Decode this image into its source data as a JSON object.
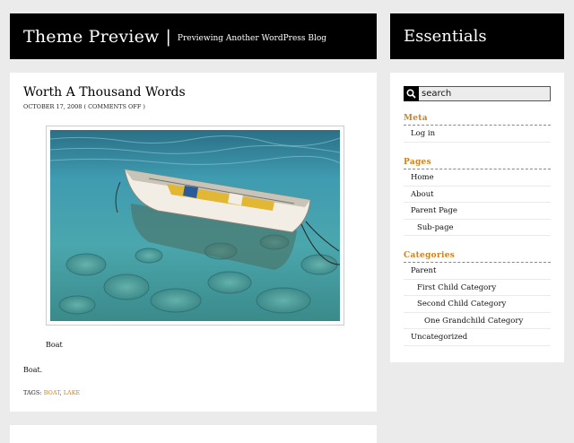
{
  "header": {
    "site_title": "Theme Preview",
    "separator": "|",
    "tagline": "Previewing Another WordPress Blog"
  },
  "sidebar_header": {
    "title": "Essentials"
  },
  "post": {
    "title": "Worth A Thousand Words",
    "date": "October 17, 2008",
    "comments": "( Comments Off )",
    "image_alt": "Boat",
    "caption": "Boat",
    "body": "Boat.",
    "tags_label": "Tags:",
    "tags": [
      "boat",
      "lake"
    ],
    "tag_separator": ", "
  },
  "sidebar": {
    "search": {
      "value": "search"
    },
    "meta": {
      "title": "Meta",
      "items": [
        "Log in"
      ]
    },
    "pages": {
      "title": "Pages",
      "items": [
        "Home",
        "About",
        "Parent Page",
        "Sub-page"
      ]
    },
    "categories": {
      "title": "Categories",
      "items": [
        "Parent",
        "First Child Category",
        "Second Child Category",
        "One Grandchild Category",
        "Uncategorized"
      ]
    }
  },
  "colors": {
    "accent": "#d4801c",
    "header_bg": "#000000",
    "page_bg": "#ebebeb"
  }
}
